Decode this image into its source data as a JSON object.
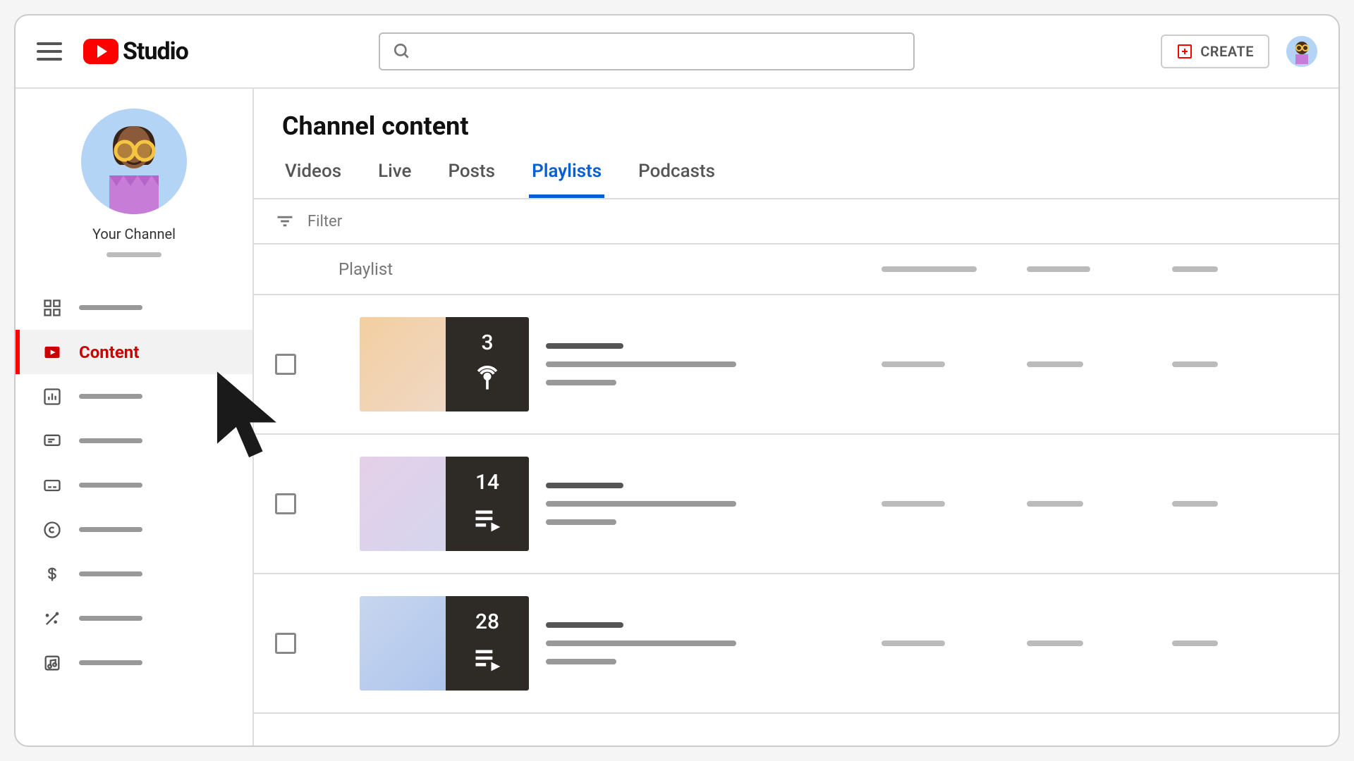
{
  "header": {
    "logo_text": "Studio",
    "create_label": "CREATE"
  },
  "sidebar": {
    "channel_label": "Your Channel",
    "items": [
      {
        "id": "dashboard"
      },
      {
        "id": "content",
        "label": "Content",
        "active": true
      },
      {
        "id": "analytics"
      },
      {
        "id": "comments"
      },
      {
        "id": "subtitles"
      },
      {
        "id": "copyright"
      },
      {
        "id": "earn"
      },
      {
        "id": "customization"
      },
      {
        "id": "audio"
      }
    ]
  },
  "page": {
    "title": "Channel content",
    "tabs": [
      "Videos",
      "Live",
      "Posts",
      "Playlists",
      "Podcasts"
    ],
    "active_tab": "Playlists",
    "filter_label": "Filter",
    "column_header": "Playlist"
  },
  "rows": [
    {
      "count": "3",
      "icon": "podcast",
      "bg": "bg1"
    },
    {
      "count": "14",
      "icon": "playlist",
      "bg": "bg2"
    },
    {
      "count": "28",
      "icon": "playlist",
      "bg": "bg3"
    }
  ]
}
